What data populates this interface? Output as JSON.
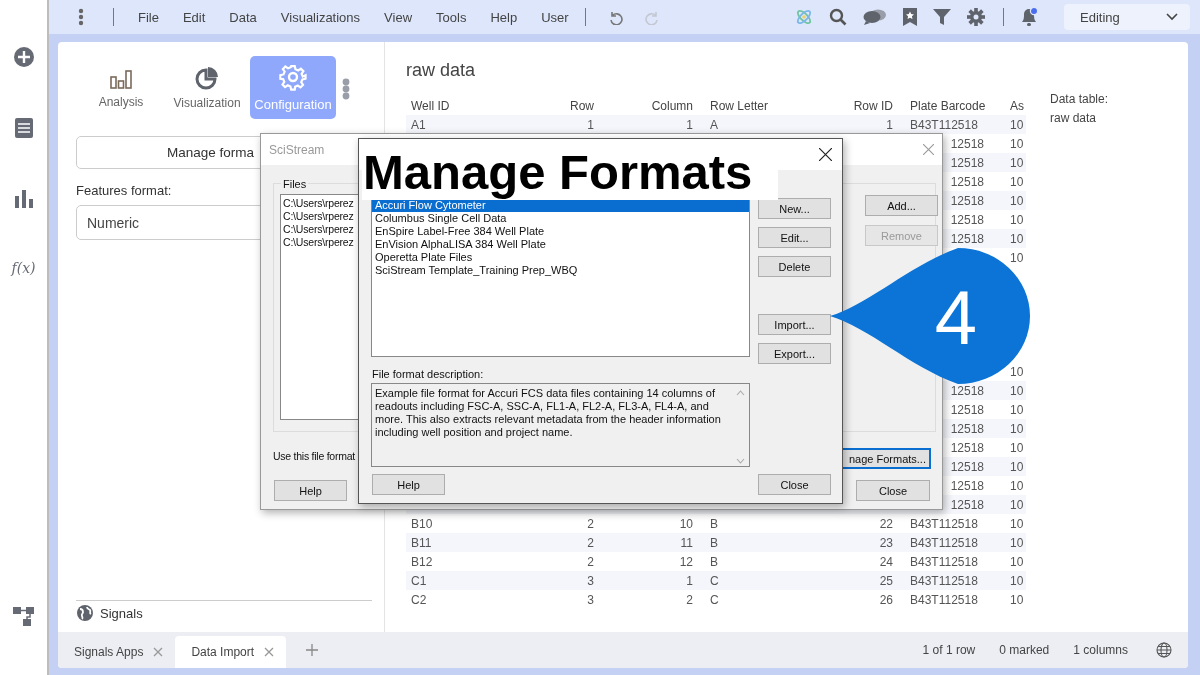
{
  "menu_bar": {
    "items": [
      "File",
      "Edit",
      "Data",
      "Visualizations",
      "View",
      "Tools",
      "Help",
      "User"
    ],
    "undo": {
      "disabled": false
    },
    "redo": {
      "disabled": true
    }
  },
  "notifications": {
    "unread": true
  },
  "mode": "Editing",
  "left_rail": {
    "formula_label": "f(x)"
  },
  "panel_tabs": [
    {
      "label": "Analysis",
      "kind": "bars",
      "selected": false
    },
    {
      "label": "Visualization",
      "kind": "pie",
      "selected": false
    },
    {
      "label": "Configuration",
      "kind": "gear",
      "selected": true
    }
  ],
  "manage_formats_button": "Manage forma",
  "features_format": {
    "label": "Features format:",
    "value": "Numeric"
  },
  "signals_link": "Signals",
  "table": {
    "title": "raw data",
    "columns": [
      "Well ID",
      "Row",
      "Column",
      "Row Letter",
      "Row ID",
      "Plate Barcode",
      "As"
    ],
    "rows": [
      {
        "cells": [
          "A1",
          "1",
          "1",
          "A",
          "1",
          "B43T112518",
          "10"
        ]
      },
      {
        "cells": [
          null,
          null,
          null,
          null,
          null,
          "12518",
          "10"
        ]
      },
      {
        "cells": [
          null,
          null,
          null,
          null,
          null,
          "12518",
          "10"
        ]
      },
      {
        "cells": [
          null,
          null,
          null,
          null,
          null,
          "12518",
          "10"
        ]
      },
      {
        "cells": [
          null,
          null,
          null,
          null,
          null,
          "12518",
          "10"
        ]
      },
      {
        "cells": [
          null,
          null,
          null,
          null,
          null,
          "12518",
          "10"
        ]
      },
      {
        "cells": [
          null,
          null,
          null,
          null,
          null,
          "12518",
          "10"
        ]
      },
      {
        "cells": [
          null,
          null,
          null,
          null,
          null,
          null,
          "10"
        ]
      },
      {
        "cells": [
          null,
          null,
          null,
          null,
          null,
          null,
          null
        ]
      },
      {
        "cells": [
          null,
          null,
          null,
          null,
          null,
          null,
          null
        ]
      },
      {
        "cells": [
          null,
          null,
          null,
          null,
          null,
          null,
          null
        ]
      },
      {
        "cells": [
          null,
          null,
          null,
          null,
          null,
          null,
          null
        ]
      },
      {
        "cells": [
          null,
          null,
          null,
          null,
          null,
          null,
          null
        ]
      },
      {
        "cells": [
          null,
          null,
          null,
          null,
          null,
          null,
          "10"
        ]
      },
      {
        "cells": [
          null,
          null,
          null,
          null,
          null,
          "12518",
          "10"
        ]
      },
      {
        "cells": [
          null,
          null,
          null,
          null,
          null,
          "12518",
          "10"
        ]
      },
      {
        "cells": [
          null,
          null,
          null,
          null,
          null,
          "12518",
          "10"
        ]
      },
      {
        "cells": [
          null,
          null,
          null,
          null,
          null,
          "12518",
          "10"
        ]
      },
      {
        "cells": [
          null,
          null,
          null,
          null,
          null,
          "12518",
          "10"
        ]
      },
      {
        "cells": [
          null,
          null,
          null,
          null,
          null,
          "12518",
          "10"
        ]
      },
      {
        "cells": [
          null,
          null,
          null,
          null,
          null,
          "12518",
          "10"
        ]
      },
      {
        "cells": [
          "B10",
          "2",
          "10",
          "B",
          "22",
          "B43T112518",
          "10"
        ]
      },
      {
        "cells": [
          "B11",
          "2",
          "11",
          "B",
          "23",
          "B43T112518",
          "10"
        ]
      },
      {
        "cells": [
          "B12",
          "2",
          "12",
          "B",
          "24",
          "B43T112518",
          "10"
        ]
      },
      {
        "cells": [
          "C1",
          "3",
          "1",
          "C",
          "25",
          "B43T112518",
          "10"
        ]
      },
      {
        "cells": [
          "C2",
          "3",
          "2",
          "C",
          "26",
          "B43T112518",
          "10"
        ]
      }
    ]
  },
  "data_table_info": {
    "label": "Data table:",
    "value": "raw data"
  },
  "document_tabs": [
    {
      "label": "Signals Apps",
      "selected": false
    },
    {
      "label": "Data Import",
      "selected": true
    }
  ],
  "status_bar": [
    "1 of 1 row",
    "0 marked",
    "1 columns"
  ],
  "scistream_dialog": {
    "title": "SciStream",
    "files_label": "Files",
    "files": [
      "C:\\Users\\rperez",
      "C:\\Users\\rperez",
      "C:\\Users\\rperez",
      "C:\\Users\\rperez"
    ],
    "buttons": [
      {
        "label": "Add...",
        "disabled": false
      },
      {
        "label": "Remove",
        "disabled": true
      }
    ],
    "use_format_label": "Use this file format",
    "help": "Help",
    "manage_formats": "nage Formats...",
    "close": "Close"
  },
  "manage_formats_dialog": {
    "caption": "Manage Formats",
    "formats": [
      {
        "label": "Accuri Flow Cytometer",
        "selected": true
      },
      {
        "label": "Columbus Single Cell Data",
        "selected": false
      },
      {
        "label": "EnSpire Label-Free 384 Well Plate",
        "selected": false
      },
      {
        "label": "EnVision AlphaLISA 384 Well Plate",
        "selected": false
      },
      {
        "label": "Operetta Plate Files",
        "selected": false
      },
      {
        "label": "SciStream Template_Training Prep_WBQ",
        "selected": false
      }
    ],
    "edit_buttons": [
      "New...",
      "Edit...",
      "Delete"
    ],
    "transfer_buttons": [
      "Import...",
      "Export..."
    ],
    "description_label": "File format description:",
    "description": "Example file format for Accuri FCS data files containing 14 columns of readouts including FSC-A, SSC-A, FL1-A, FL2-A, FL3-A, FL4-A, and more. This also extracts relevant metadata from the header information including well position and project name.",
    "help": "Help",
    "close": "Close"
  },
  "callout": {
    "number": "4"
  }
}
